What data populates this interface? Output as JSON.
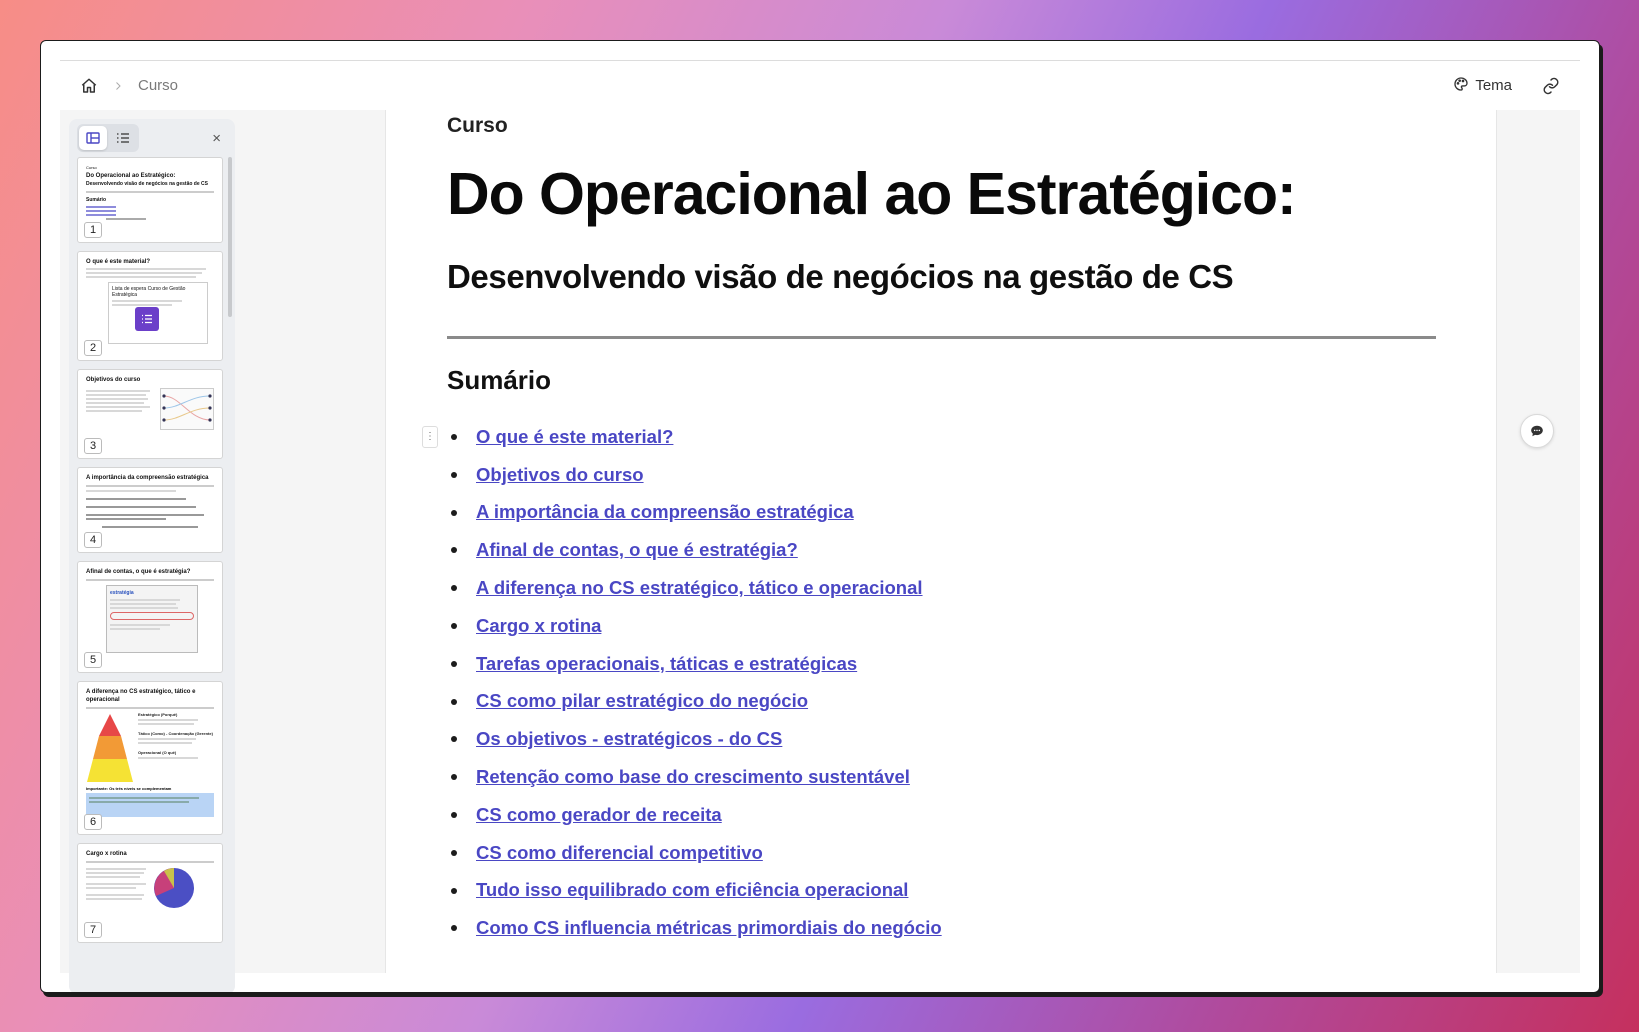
{
  "header": {
    "breadcrumb": [
      "Curso"
    ],
    "theme_label": "Tema"
  },
  "sidebar": {
    "close_symbol": "×",
    "thumbnails": [
      {
        "num": "1",
        "kicker": "Curso",
        "title": "Do Operacional ao Estratégico:",
        "subtitle": "Desenvolvendo visão de negócios na gestão de CS",
        "section": "Sumário"
      },
      {
        "num": "2",
        "title": "O que é este material?",
        "card_title": "Lista de espera Curso de Gestão Estratégica"
      },
      {
        "num": "3",
        "title": "Objetivos do curso"
      },
      {
        "num": "4",
        "title": "A importância da compreensão estratégica"
      },
      {
        "num": "5",
        "title": "Afinal de contas, o que é estratégia?",
        "card_title": "estratégia"
      },
      {
        "num": "6",
        "title": "A diferença no CS estratégico, tático e operacional",
        "levels": [
          "Estratégico (Porquê)",
          "Tático (Como) - Coordenação (Gerente)",
          "Operacional (O quê)"
        ],
        "note": "Importante: Os três níveis se complementam"
      },
      {
        "num": "7",
        "title": "Cargo x rotina"
      }
    ]
  },
  "document": {
    "kicker": "Curso",
    "title": "Do Operacional ao Estratégico:",
    "subtitle": "Desenvolvendo visão de negócios na gestão de CS",
    "toc_heading": "Sumário",
    "toc": [
      "O que é este material?",
      "Objetivos do curso",
      "A importância da compreensão estratégica",
      "Afinal de contas, o que é estratégia?",
      "A diferença no CS estratégico, tático e operacional",
      "Cargo x rotina",
      "Tarefas operacionais, táticas e estratégicas",
      "CS como pilar estratégico do negócio",
      "Os objetivos - estratégicos - do CS",
      "Retenção como base do crescimento sustentável",
      "CS como gerador de receita",
      "CS como diferencial competitivo",
      "Tudo isso equilibrado com eficiência operacional",
      "Como CS influencia métricas primordiais do negócio"
    ]
  },
  "colors": {
    "link": "#4a47c4",
    "accent_purple": "#6b3fc9"
  },
  "icons": [
    "home-icon",
    "chevron-right-icon",
    "palette-icon",
    "link-icon",
    "grid-view-icon",
    "list-view-icon",
    "close-icon",
    "drag-handle-icon",
    "comment-icon"
  ]
}
